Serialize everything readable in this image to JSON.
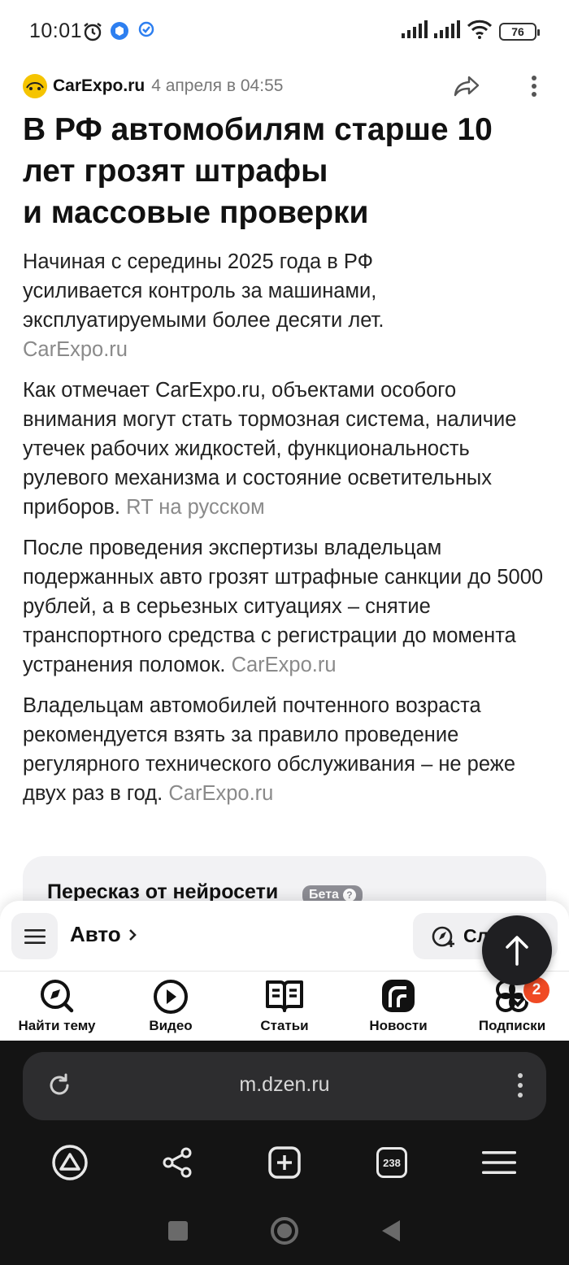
{
  "status_bar": {
    "time": "10:01",
    "battery": "76"
  },
  "article": {
    "source_name": "CarExpo.ru",
    "date": "4 апреля в 04:55",
    "title_lines": [
      "В РФ автомобилям старше 10",
      "лет грозят штрафы",
      "и массовые проверки"
    ],
    "paragraphs": [
      {
        "text": "Начиная с середины 2025 года в РФ усиливается контроль за машинами, эксплуатируемыми более десяти лет.",
        "cite": "CarExpo.ru"
      },
      {
        "text": "Как отмечает CarExpo.ru, объектами особого внимания могут стать тормозная система, наличие утечек рабочих жидкостей, функциональность рулевого механизма и состояние осветительных приборов.",
        "cite": "RT на русском"
      },
      {
        "text": "После проведения экспертизы владельцам подержанных авто грозят штрафные санкции до 5000 рублей, а в серьезных ситуациях – снятие транспортного средства с регистрации до момента устранения поломок.",
        "cite": "CarExpo.ru"
      },
      {
        "text": "Владельцам автомобилей почтенного возраста рекомендуется взять за правило проведение регулярного технического обслуживания – не реже двух раз в год.",
        "cite": "CarExpo.ru"
      }
    ]
  },
  "ai_card": {
    "title": "Пересказ от нейросети",
    "badge": "Бета"
  },
  "panel": {
    "channel": "Авто",
    "subscribe_label": "Сл"
  },
  "bottom_nav": [
    {
      "label": "Найти тему",
      "icon": "compass-icon"
    },
    {
      "label": "Видео",
      "icon": "video-icon"
    },
    {
      "label": "Статьи",
      "icon": "book-icon"
    },
    {
      "label": "Новости",
      "icon": "news-icon"
    },
    {
      "label": "Подписки",
      "icon": "subscriptions-icon",
      "badge": "2"
    }
  ],
  "browser": {
    "url": "m.dzen.ru",
    "tabs_count": "238"
  },
  "colors": {
    "accent": "#f04a24",
    "source_logo": "#f5c400",
    "muted_text": "#8a8a8a"
  }
}
